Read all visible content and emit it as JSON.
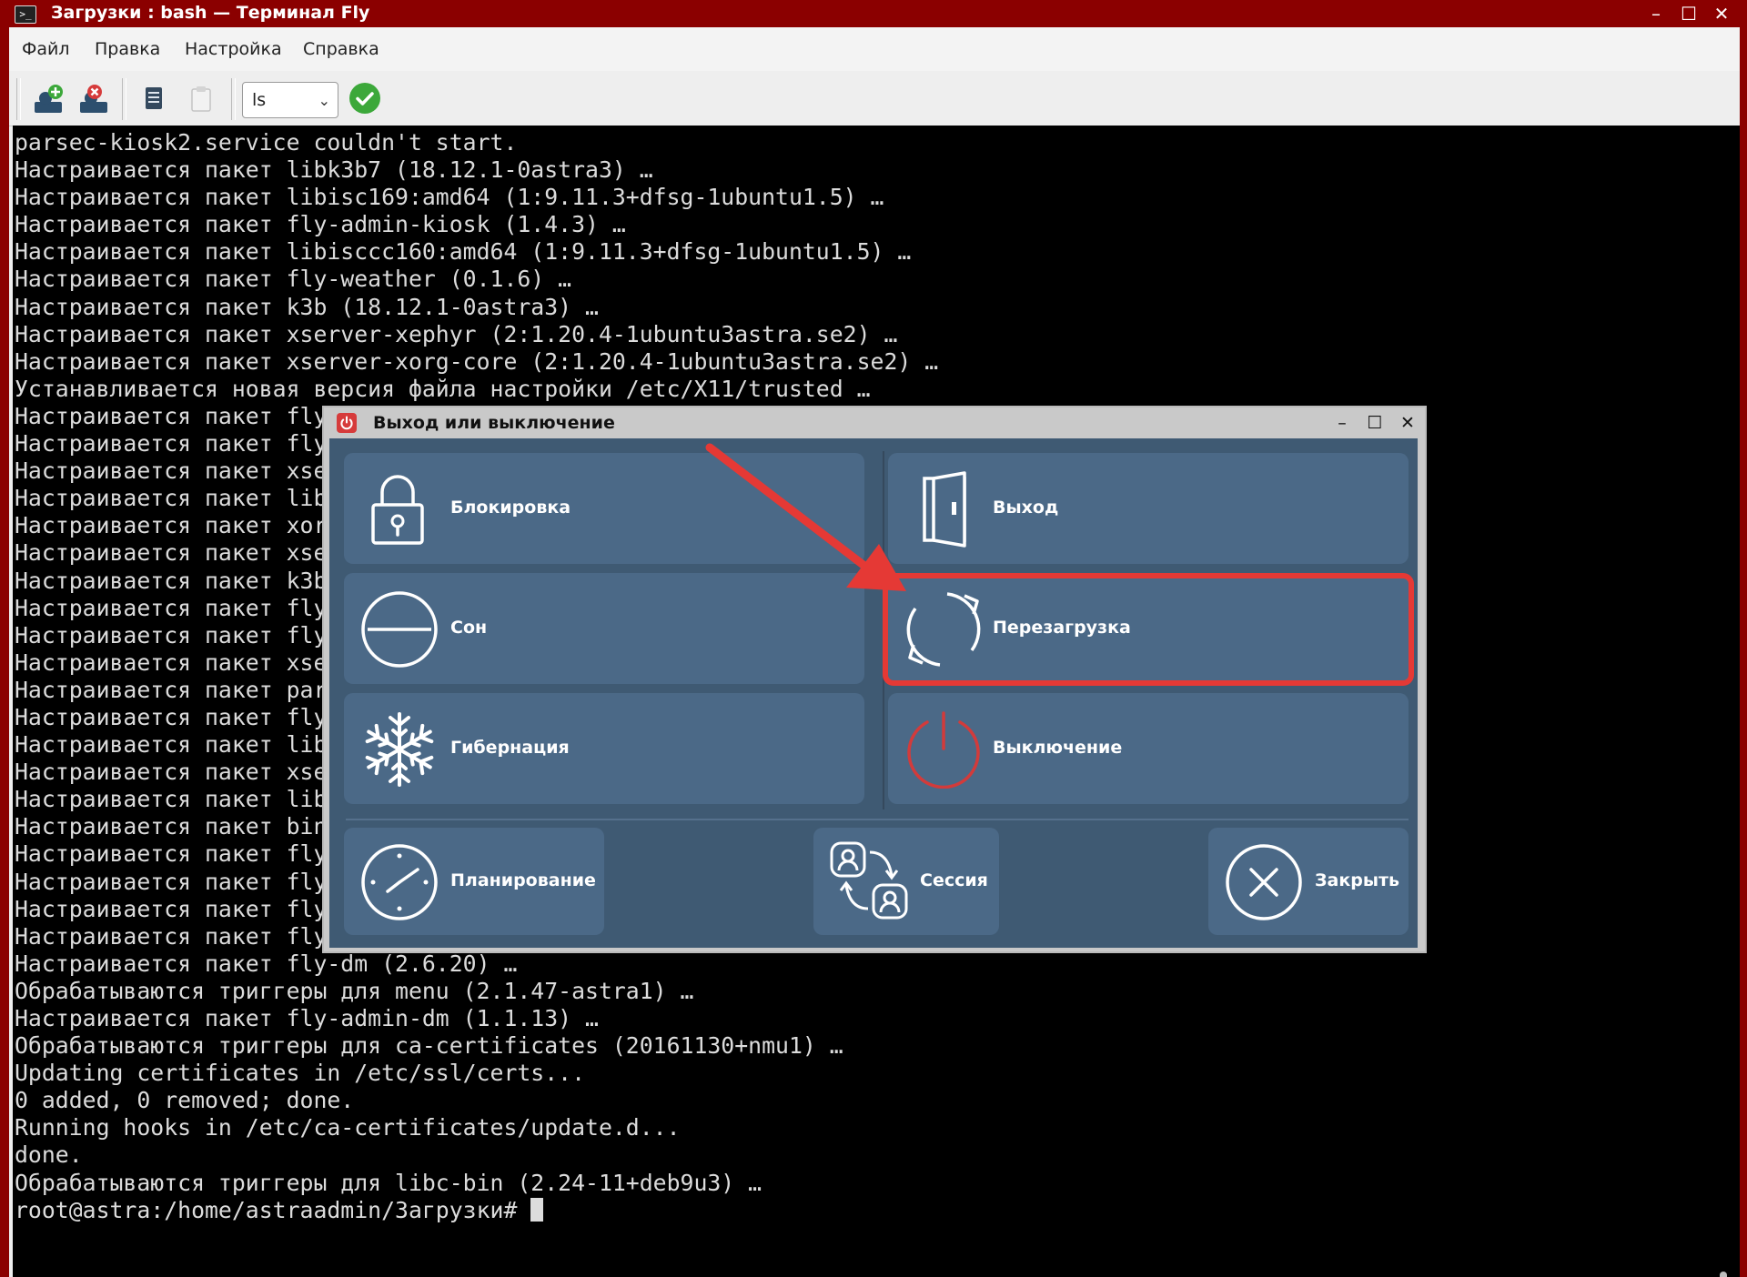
{
  "window": {
    "title": "Загрузки : bash — Терминал Fly",
    "app_icon": ">_",
    "minimize_glyph": "–",
    "maximize_glyph": "☐",
    "close_glyph": "✕"
  },
  "menubar": {
    "items": [
      {
        "label": "Файл"
      },
      {
        "label": "Правка"
      },
      {
        "label": "Настройка"
      },
      {
        "label": "Справка"
      }
    ]
  },
  "toolbar": {
    "buttons": [
      {
        "icon": "add-session-icon"
      },
      {
        "icon": "remove-session-icon"
      },
      {
        "icon": "copy-icon"
      },
      {
        "icon": "paste-icon"
      }
    ],
    "command_select": {
      "value": "ls"
    },
    "run_icon": "checkmark-icon"
  },
  "terminal": {
    "lines": [
      "parsec-kiosk2.service couldn't start.",
      "Настраивается пакет libk3b7 (18.12.1-0astra3) …",
      "Настраивается пакет libisc169:amd64 (1:9.11.3+dfsg-1ubuntu1.5) …",
      "Настраивается пакет fly-admin-kiosk (1.4.3) …",
      "Настраивается пакет libisccc160:amd64 (1:9.11.3+dfsg-1ubuntu1.5) …",
      "Настраивается пакет fly-weather (0.1.6) …",
      "Настраивается пакет k3b (18.12.1-0astra3) …",
      "Настраивается пакет xserver-xephyr (2:1.20.4-1ubuntu3astra.se2) …",
      "Настраивается пакет xserver-xorg-core (2:1.20.4-1ubuntu3astra.se2) …",
      "Устанавливается новая версия файла настройки /etc/X11/trusted …",
      "Настраивается пакет fly",
      "Настраивается пакет fly",
      "Настраивается пакет xse",
      "Настраивается пакет lib",
      "Настраивается пакет xor",
      "Настраивается пакет xse",
      "Настраивается пакет k3b",
      "Настраивается пакет fly",
      "Настраивается пакет fly",
      "Настраивается пакет xse",
      "Настраивается пакет par",
      "Настраивается пакет fly",
      "Настраивается пакет lib",
      "Настраивается пакет xse",
      "Настраивается пакет lib",
      "Настраивается пакет bin",
      "Настраивается пакет fly",
      "Настраивается пакет fly",
      "Настраивается пакет fly",
      "Настраивается пакет fly",
      "Настраивается пакет fly-dm (2.6.20) …",
      "Обрабатываются триггеры для menu (2.1.47-astra1) …",
      "Настраивается пакет fly-admin-dm (1.1.13) …",
      "Обрабатываются триггеры для ca-certificates (20161130+nmu1) …",
      "Updating certificates in /etc/ssl/certs...",
      "0 added, 0 removed; done.",
      "Running hooks in /etc/ca-certificates/update.d...",
      "done.",
      "Обрабатываются триггеры для libc-bin (2.24-11+deb9u3) …"
    ],
    "prompt": "root@astra:/home/astraadmin/Загрузки# "
  },
  "dialog": {
    "title": "Выход или выключение",
    "icon": "power-icon",
    "minimize_glyph": "–",
    "maximize_glyph": "☐",
    "close_glyph": "✕",
    "actions": {
      "lock": {
        "label": "Блокировка",
        "icon": "lock-icon"
      },
      "logout": {
        "label": "Выход",
        "icon": "door-exit-icon"
      },
      "sleep": {
        "label": "Сон",
        "icon": "sleep-icon"
      },
      "reboot": {
        "label": "Перезагрузка",
        "icon": "reboot-icon"
      },
      "hibernate": {
        "label": "Гибернация",
        "icon": "snowflake-icon"
      },
      "shutdown": {
        "label": "Выключение",
        "icon": "power-icon"
      },
      "schedule": {
        "label": "Планирование",
        "icon": "clock-icon"
      },
      "session": {
        "label": "Сессия",
        "icon": "switch-user-icon"
      },
      "close": {
        "label": "Закрыть",
        "icon": "close-icon"
      }
    }
  },
  "annotation": {
    "highlight_color": "#e53935",
    "highlighted_item": "reboot"
  },
  "colors": {
    "window_frame": "#8b0000",
    "dialog_background": "#3f5a73",
    "tile_background": "#4b6987",
    "terminal_background": "#000000"
  }
}
